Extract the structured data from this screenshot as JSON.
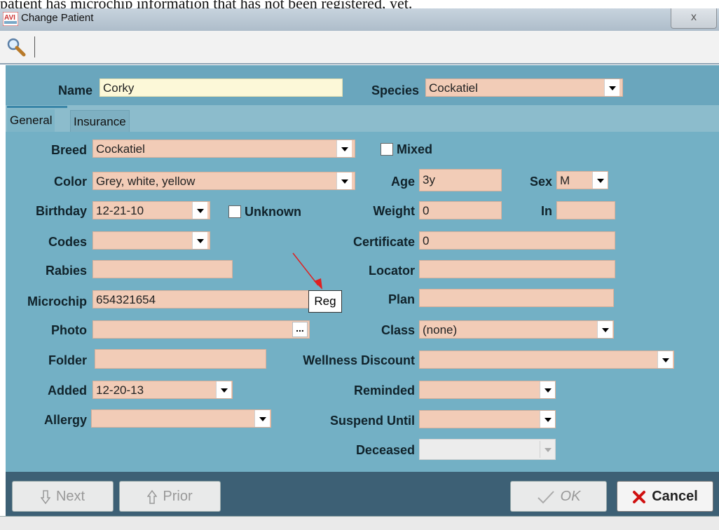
{
  "caption": "patient has microchip information that has not been registered, yet.",
  "window": {
    "title": "Change Patient",
    "app_icon": "avimark-app-icon",
    "close_glyph": "x"
  },
  "toolbar": {
    "search_icon": "search-icon"
  },
  "header": {
    "name_label": "Name",
    "name_value": "Corky",
    "species_label": "Species",
    "species_value": "Cockatiel"
  },
  "tabs": [
    {
      "label": "General",
      "active": true
    },
    {
      "label": "Insurance",
      "active": false
    }
  ],
  "form": {
    "breed_label": "Breed",
    "breed_value": "Cockatiel",
    "mixed_label": "Mixed",
    "color_label": "Color",
    "color_value": "Grey, white, yellow",
    "age_label": "Age",
    "age_value": "3y",
    "sex_label": "Sex",
    "sex_value": "M",
    "birthday_label": "Birthday",
    "birthday_value": "12-21-10",
    "unknown_label": "Unknown",
    "weight_label": "Weight",
    "weight_value": "0",
    "in_label": "In",
    "in_value": "",
    "codes_label": "Codes",
    "codes_value": "",
    "certificate_label": "Certificate",
    "certificate_value": "0",
    "rabies_label": "Rabies",
    "rabies_value": "",
    "locator_label": "Locator",
    "locator_value": "",
    "microchip_label": "Microchip",
    "microchip_value": "654321654",
    "reg_label": "Reg",
    "plan_label": "Plan",
    "plan_value": "",
    "photo_label": "Photo",
    "photo_value": "",
    "photo_browse": "...",
    "class_label": "Class",
    "class_value": "(none)",
    "folder_label": "Folder",
    "folder_value": "",
    "wellness_label": "Wellness Discount",
    "wellness_value": "",
    "added_label": "Added",
    "added_value": "12-20-13",
    "reminded_label": "Reminded",
    "reminded_value": "",
    "allergy_label": "Allergy",
    "allergy_value": "",
    "suspend_label": "Suspend Until",
    "suspend_value": "",
    "deceased_label": "Deceased",
    "deceased_value": ""
  },
  "buttons": {
    "next": "Next",
    "prior": "Prior",
    "ok": "OK",
    "cancel": "Cancel"
  },
  "colors": {
    "field_bg": "#f2ccb7",
    "name_field_bg": "#fcf8d8",
    "panel_bg": "#73b0c5",
    "header_bg": "#6aa6bd",
    "footer_bg": "#3d6075",
    "annotation_arrow": "#e02020",
    "cancel_x": "#d01010"
  }
}
